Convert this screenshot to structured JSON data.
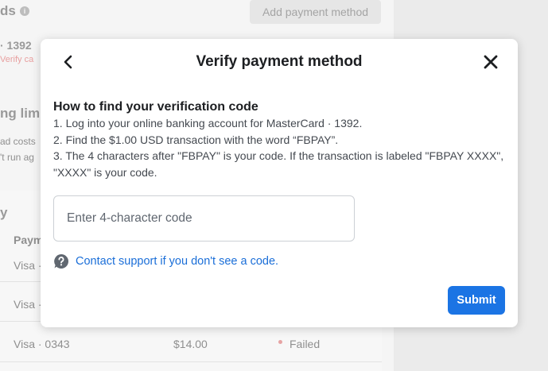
{
  "background": {
    "section_title_fragment": "ds",
    "add_payment_button": "Add payment method",
    "card_fragment": "· 1392",
    "verify_fragment": "Verify ca",
    "spending_fragment": "ng limit",
    "costs_fragment": "ad costs",
    "run_fragment": "'t run ag",
    "activity_fragment": "y",
    "payment_col_fragment": "Paym",
    "rows": [
      {
        "method": "Visa ·"
      },
      {
        "method": "Visa ·"
      },
      {
        "method": "Visa · 0343",
        "amount": "$14.00",
        "status": "Failed"
      }
    ]
  },
  "modal": {
    "title": "Verify payment method",
    "instructions": {
      "heading": "How to find your verification code",
      "steps": [
        "1. Log into your online banking account for MasterCard · 1392.",
        "2. Find the $1.00 USD transaction with the word “FBPAY”.",
        "3. The 4 characters after \"FBPAY\" is your code. If the transaction is labeled \"FBPAY XXXX\", \"XXXX\" is your code."
      ]
    },
    "code_input": {
      "placeholder": "Enter 4-character code",
      "value": ""
    },
    "support_link": "Contact support if you don't see a code.",
    "submit_label": "Submit"
  },
  "colors": {
    "accent": "#1b74e4",
    "link": "#1a6ed8",
    "title_text": "#1c1e21",
    "body_text": "#444950",
    "failed_status": "#e6a3a3"
  },
  "icons": {
    "back": "chevron-left-icon",
    "close": "close-icon",
    "support": "question-bubble-icon",
    "info": "info-icon"
  }
}
